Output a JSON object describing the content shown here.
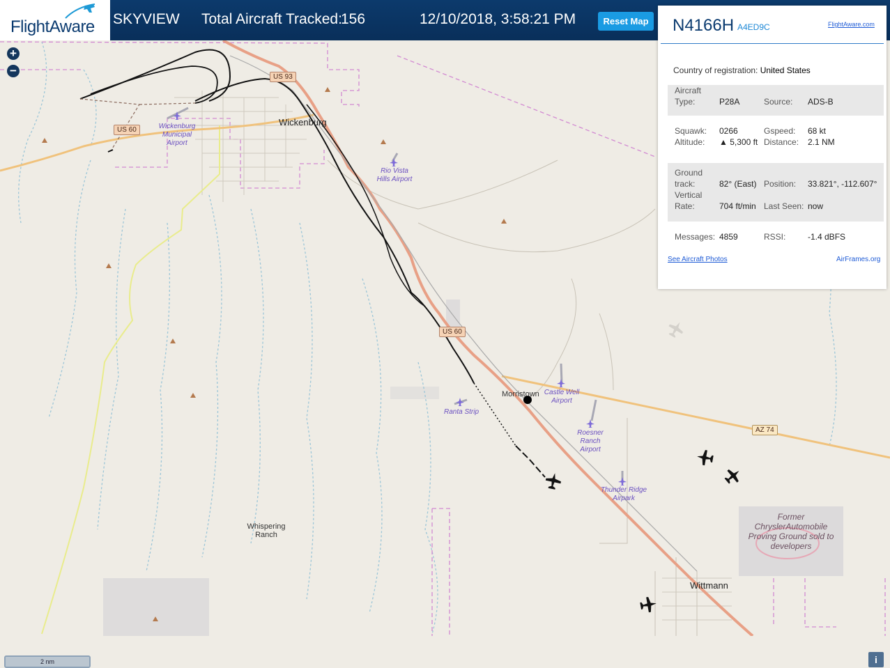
{
  "header": {
    "logo_text": "FlightAware",
    "app_title": "SKYVIEW",
    "tracked_label": "Total Aircraft Tracked:",
    "tracked_count": "156",
    "datetime": "12/10/2018, 3:58:21 PM",
    "reset_label": "Reset Map"
  },
  "map": {
    "zoom_in": "+",
    "zoom_out": "−",
    "scale": "2 nm",
    "info": "i",
    "roads": [
      "US 93",
      "US 60",
      "US 60",
      "AZ 74"
    ],
    "places": {
      "wickenburg": "Wickenburg",
      "morristown": "Morristown",
      "wittmann": "Wittmann",
      "whispering_ranch": "Whispering Ranch"
    },
    "airports": {
      "wickenburg": "Wickenburg Municipal Airport",
      "rio_vista": "Rio Vista Hills Airport",
      "castle_well": "Castle Well Airport",
      "ranta": "Ranta Strip",
      "roesner": "Roesner Ranch Airport",
      "thunder_ridge": "Thunder Ridge Airpark"
    },
    "proving_ground": "Former ChryslerAutomobile Proving Ground sold to developers"
  },
  "panel": {
    "registration": "N4166H",
    "hex": "A4ED9C",
    "fa_link": "FlightAware.com",
    "country_label": "Country of registration:",
    "country_value": "United States",
    "aircraft_type_label": "Aircraft Type:",
    "aircraft_type": "P28A",
    "source_label": "Source:",
    "source": "ADS-B",
    "squawk_label": "Squawk:",
    "squawk": "0266",
    "gspeed_label": "Gspeed:",
    "gspeed": "68 kt",
    "altitude_label": "Altitude:",
    "altitude": "▲ 5,300 ft",
    "distance_label": "Distance:",
    "distance": "2.1 NM",
    "ground_track_label": "Ground track:",
    "ground_track": "82° (East)",
    "position_label": "Position:",
    "position": "33.821°, -112.607°",
    "vertical_rate_label": "Vertical Rate:",
    "vertical_rate": "704 ft/min",
    "last_seen_label": "Last Seen:",
    "last_seen": "now",
    "messages_label": "Messages:",
    "messages": "4859",
    "rssi_label": "RSSI:",
    "rssi": "-1.4 dBFS",
    "photos_link": "See Aircraft Photos",
    "airframes_link": "AirFrames.org"
  },
  "colors": {
    "header_bg": "#0c3a6c",
    "button_blue": "#1a9be3",
    "highway": "#e8a086",
    "state_route": "#f3c07c",
    "boundary": "#d28ad2",
    "track": "#000000"
  }
}
